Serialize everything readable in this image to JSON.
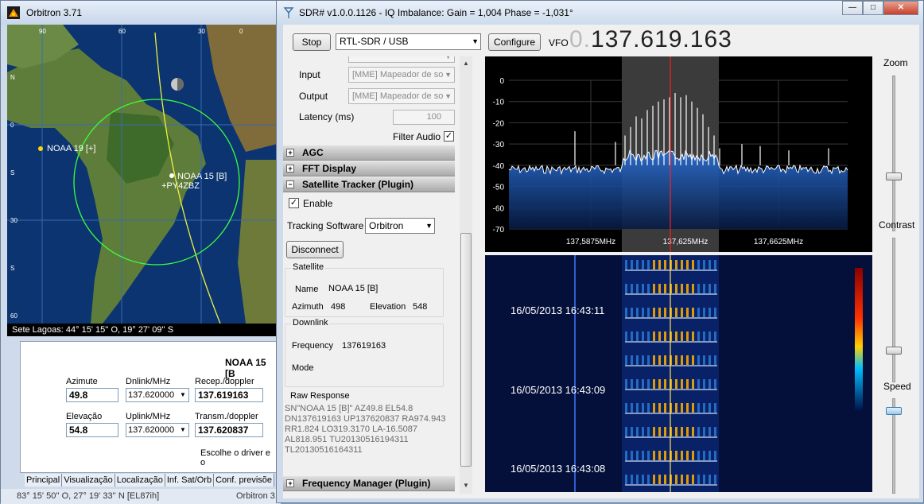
{
  "orbitron": {
    "title": "Orbitron 3.71",
    "map": {
      "longitude_labels": [
        "90",
        "60",
        "30",
        "0"
      ],
      "latitude_labels": [
        "N",
        "0",
        "S",
        "30",
        "S",
        "60"
      ],
      "satellites": [
        {
          "name": "NOAA 19 [+]"
        },
        {
          "name": "NOAA 15 [B]"
        }
      ],
      "observer": "+PY4ZBZ"
    },
    "location_text": "Sete Lagoas: 44° 15' 15'' O, 19° 27' 09'' S",
    "panel": {
      "satellite_name": "NOAA 15 [B",
      "azimute_label": "Azimute",
      "azimute_value": "49.8",
      "dnlink_label": "Dnlink/MHz",
      "dnlink_value": "137.620000",
      "recep_label": "Recep./doppler",
      "recep_value": "137.619163",
      "elevacao_label": "Elevação",
      "elevacao_value": "54.8",
      "uplink_label": "Uplink/MHz",
      "uplink_value": "137.620000",
      "transm_label": "Transm./doppler",
      "transm_value": "137.620837",
      "driver_text": "Escolhe o driver e o"
    },
    "tabs": [
      "Principal",
      "Visualização",
      "Localização",
      "Inf. Sat/Orb",
      "Conf. previsõe"
    ],
    "status_left": "83° 15' 50'' O, 27° 19' 33'' N [EL87ih]",
    "status_right": "Orbitron 3."
  },
  "sdr": {
    "title": "SDR# v1.0.0.1126 - IQ Imbalance: Gain = 1,004 Phase = -1,031°",
    "window_buttons": {
      "minimize": "—",
      "maximize": "□",
      "close": "✕"
    },
    "toolbar": {
      "stop_label": "Stop",
      "device_value": "RTL-SDR / USB",
      "configure_label": "Configure",
      "vfo_label": "VFO",
      "vfo_dim": "0.",
      "vfo_value": "137.619.163"
    },
    "audio": {
      "input_label": "Input",
      "input_value": "[MME] Mapeador de so",
      "output_label": "Output",
      "output_value": "[MME] Mapeador de so",
      "latency_label": "Latency (ms)",
      "latency_value": "100",
      "filter_label": "Filter Audio",
      "filter_checked": true
    },
    "sections": {
      "agc": "AGC",
      "fft": "FFT Display",
      "tracker": "Satellite Tracker (Plugin)",
      "freq_manager": "Frequency Manager (Plugin)"
    },
    "tracker": {
      "enable_label": "Enable",
      "enable_checked": true,
      "software_label": "Tracking Software",
      "software_value": "Orbitron",
      "disconnect_label": "Disconnect",
      "satellite_group": "Satellite",
      "name_label": "Name",
      "name_value": "NOAA 15 [B]",
      "azimuth_label": "Azimuth",
      "azimuth_value": "498",
      "elevation_label": "Elevation",
      "elevation_value": "548",
      "downlink_group": "Downlink",
      "frequency_label": "Frequency",
      "frequency_value": "137619163",
      "mode_label": "Mode",
      "raw_label": "Raw Response",
      "raw_lines": [
        "SN\"NOAA 15 [B]\" AZ49.8 EL54.8",
        "DN137619163 UP137620837 RA974.943",
        "RR1.824 LO319.3170 LA-16.5087",
        "AL818.951 TU20130516194311",
        "TL20130516164311"
      ]
    },
    "spectrum": {
      "y_ticks": [
        "0",
        "-10",
        "-20",
        "-30",
        "-40",
        "-50",
        "-60",
        "-70"
      ],
      "x_ticks": [
        "137,5875MHz",
        "137,625MHz",
        "137,6625MHz"
      ]
    },
    "waterfall": {
      "timestamps": [
        "16/05/2013 16:43:11",
        "16/05/2013 16:43:09",
        "16/05/2013 16:43:08"
      ]
    },
    "sliders": {
      "zoom_label": "Zoom",
      "contrast_label": "Contrast",
      "speed_label": "Speed"
    },
    "colors": {
      "spectrum_fill": "#2a6fd6",
      "center_line": "#ff2020",
      "passband": "#5a5a5a",
      "waterfall_bg": "#04103a"
    }
  }
}
